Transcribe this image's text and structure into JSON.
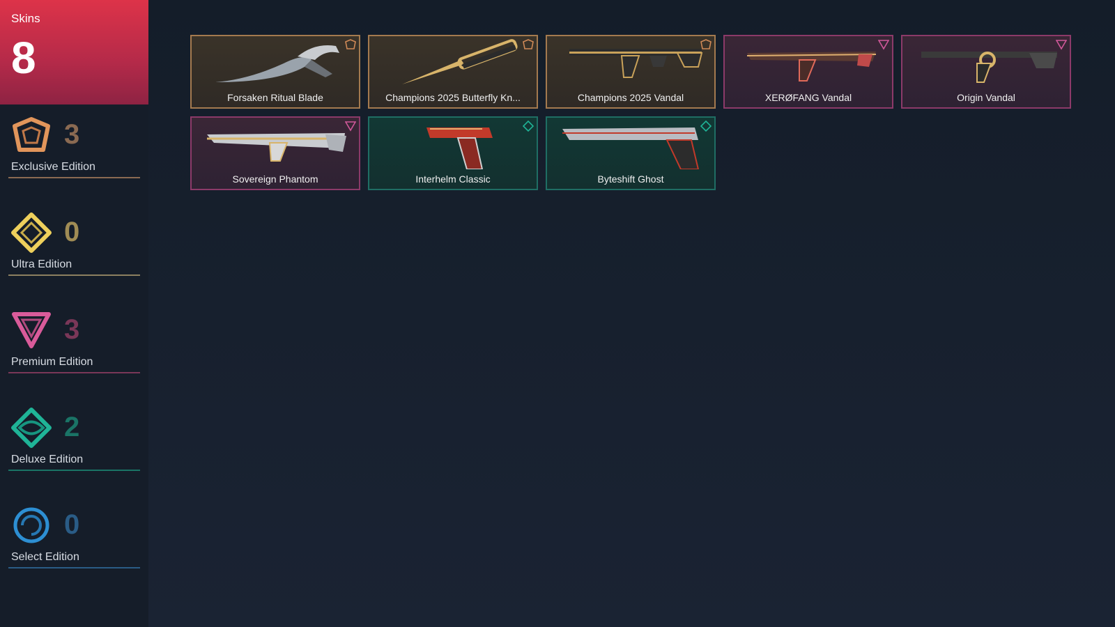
{
  "sidebar": {
    "skins_label": "Skins",
    "skins_count": "8",
    "tiers": [
      {
        "label": "Exclusive Edition",
        "count": "3",
        "color": "#e1955b",
        "count_color": "#8a6a52",
        "icon": "exclusive-edition-icon"
      },
      {
        "label": "Ultra Edition",
        "count": "0",
        "color": "#eed05c",
        "count_color": "#a08c55",
        "icon": "ultra-edition-icon"
      },
      {
        "label": "Premium Edition",
        "count": "3",
        "color": "#d95b9a",
        "count_color": "#7a3758",
        "icon": "premium-edition-icon"
      },
      {
        "label": "Deluxe Edition",
        "count": "2",
        "color": "#1fb497",
        "count_color": "#1a7466",
        "icon": "deluxe-edition-icon"
      },
      {
        "label": "Select Edition",
        "count": "0",
        "color": "#2d8fd3",
        "count_color": "#2a5c86",
        "icon": "select-edition-icon"
      }
    ]
  },
  "skins": [
    {
      "name": "Forsaken Ritual Blade",
      "tier": "exclusive"
    },
    {
      "name": "Champions 2025 Butterfly Kn...",
      "tier": "exclusive"
    },
    {
      "name": "Champions 2025 Vandal",
      "tier": "exclusive"
    },
    {
      "name": "XERØFANG Vandal",
      "tier": "premium"
    },
    {
      "name": "Origin Vandal",
      "tier": "premium"
    },
    {
      "name": "Sovereign Phantom",
      "tier": "premium"
    },
    {
      "name": "Interhelm Classic",
      "tier": "deluxe"
    },
    {
      "name": "Byteshift Ghost",
      "tier": "deluxe"
    }
  ]
}
